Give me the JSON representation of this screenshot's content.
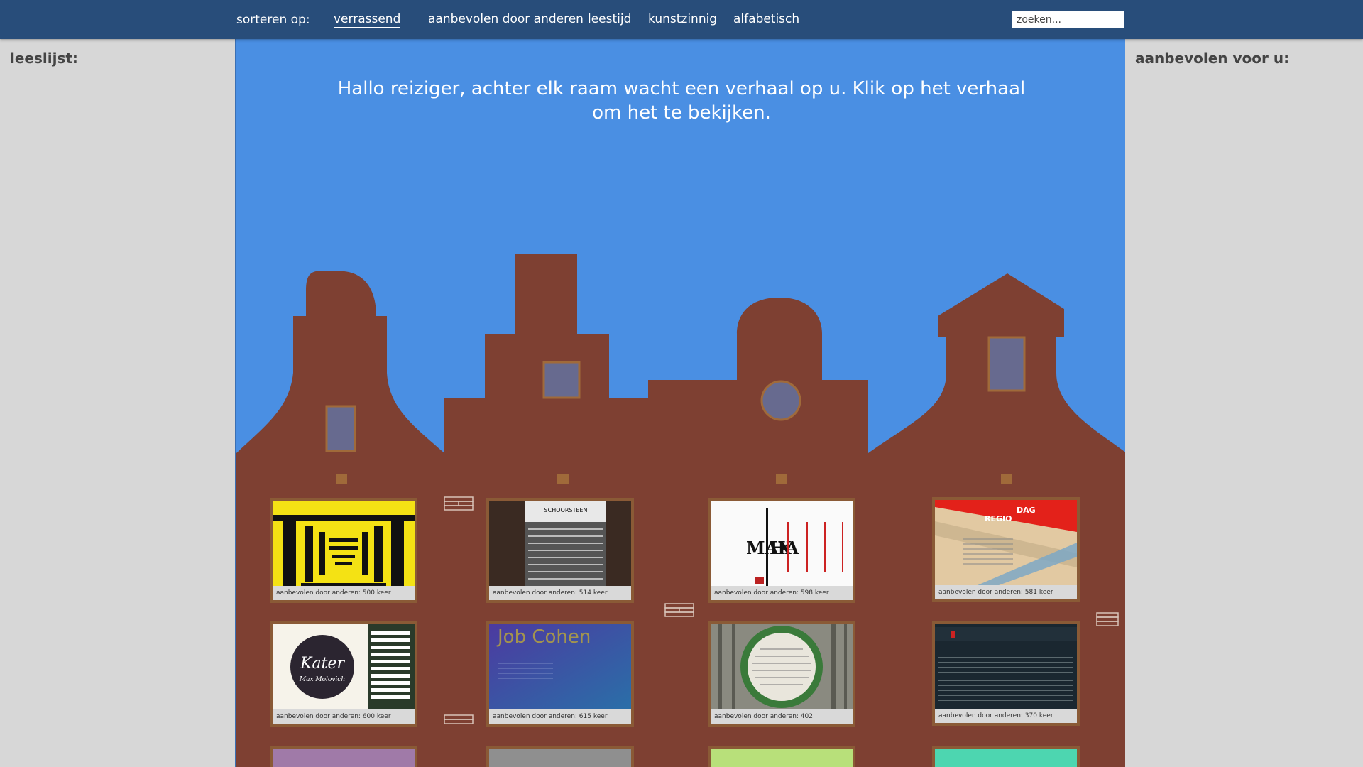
{
  "nav": {
    "sort_label": "sorteren op:",
    "items": [
      {
        "label": "verrassend"
      },
      {
        "label": "aanbevolen door anderen"
      },
      {
        "label": "leestijd"
      },
      {
        "label": "kunstzinnig"
      },
      {
        "label": "alfabetisch"
      }
    ],
    "search_placeholder": "zoeken..."
  },
  "left_sidebar": {
    "title": "leeslijst:"
  },
  "right_sidebar": {
    "title": "aanbevolen voor u:"
  },
  "main": {
    "welcome": "Hallo reiziger, achter elk raam wacht een verhaal op u. Klik op het verhaal om het te bekijken."
  },
  "colors": {
    "topbar": "#284d7a",
    "sky": "#4a8fe3",
    "house": "#7e4032",
    "window_frame": "#8a5a36",
    "gable_window": "#676a8f"
  },
  "stories": [
    {
      "caption": "aanbevolen door anderen: 500 keer",
      "cover": "yellow-tunnel"
    },
    {
      "caption": "aanbevolen door anderen: 514 keer",
      "cover": "schoorsteen"
    },
    {
      "caption": "aanbevolen door anderen: 598 keer",
      "cover": "max-ha"
    },
    {
      "caption": "aanbevolen door anderen: 581 keer",
      "cover": "dag-regio"
    },
    {
      "caption": "aanbevolen door anderen: 600 keer",
      "cover": "kater"
    },
    {
      "caption": "aanbevolen door anderen: 615 keer",
      "cover": "job-cohen"
    },
    {
      "caption": "aanbevolen door anderen: 402",
      "cover": "circle-forest"
    },
    {
      "caption": "aanbevolen door anderen: 370 keer",
      "cover": "dark-article"
    }
  ],
  "cover_text": {
    "schoorsteen": "SCHOORSTEEN",
    "max": "MAX",
    "ha": "HA",
    "dag": "DAG",
    "regio": "REGIO",
    "kater": "Kater",
    "kater_author": "Max Molovich",
    "job_cohen": "Job Cohen"
  }
}
